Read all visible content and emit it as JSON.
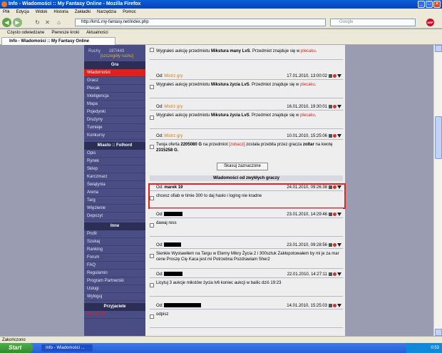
{
  "window": {
    "title": "Info - Wiadomości :: My Fantasy Online - Mozilla Firefox",
    "buttons": [
      "_",
      "□",
      "×"
    ]
  },
  "menu": [
    "Plik",
    "Edycja",
    "Widok",
    "Historia",
    "Zakładki",
    "Narzędzia",
    "Pomoc"
  ],
  "nav": {
    "url": "http://km1.my-fantasy.net/index.php",
    "search_placeholder": "Google",
    "back": "◀",
    "forward": "▶",
    "reload": "↻",
    "stop": "✕",
    "home": "⌂",
    "abp": "ABP"
  },
  "bookmarks": [
    "Często odwiedzane",
    "Pierwsze kroki",
    "Aktualności"
  ],
  "tab": {
    "label": "Info - Wiadomości :: My Fantasy Online"
  },
  "sidebar": {
    "stat_label": "Ruchy",
    "stat_value": "197/443",
    "stat_link": "[szczegóły ruchu]",
    "sections": [
      {
        "title": "Gra",
        "items": [
          "Wiadomości",
          "Gracz",
          "Plecak",
          "Inteligencja",
          "Mapa",
          "Pojedynki",
          "Drużyny",
          "Turnieje",
          "Konkursy"
        ]
      },
      {
        "title": "Miasto :: Folhord",
        "items": [
          "Opis",
          "Rynek",
          "Sklep",
          "Karczmarz",
          "Świątynia",
          "Arena",
          "Targ",
          "Więzienie",
          "Depozyt"
        ]
      },
      {
        "title": "Inne",
        "items": [
          "Profil",
          "Szukaj",
          "Ranking",
          "Forum",
          "FAQ",
          "Regulamin",
          "Program Partnerski",
          "Usługi",
          "Wyloguj"
        ]
      },
      {
        "title": "Przyjaciele",
        "items": [
          "marek 19"
        ]
      }
    ],
    "active": "Wiadomości"
  },
  "messages": [
    {
      "body_pre": "Wygrałeś aukcję przedmiotu ",
      "item": "Mikstura many LvS",
      "body_post": ". Przedmiot znajduje się w ",
      "link": "plecaku",
      "end": "."
    },
    {
      "from_label": "Od:",
      "from": "Mistrz gry",
      "date": "17.01.2010, 13:00:02",
      "body_pre": "Wygrałeś aukcję przedmiotu ",
      "item": "Mikstura życia LvS",
      "body_post": ". Przedmiot znajduje się w ",
      "link": "plecaku",
      "end": "."
    },
    {
      "from_label": "Od:",
      "from": "Mistrz gry",
      "date": "16.01.2010, 19:30:01",
      "body_pre": "Wygrałeś aukcję przedmiotu ",
      "item": "Mikstura życia LvS",
      "body_post": ". Przedmiot znajduje się w ",
      "link": "plecaku",
      "end": "."
    },
    {
      "from_label": "Od:",
      "from": "Mistrz gry",
      "date": "10.01.2010, 15:25:06",
      "body_pre": "Twoja oferta ",
      "item": "2205080 G",
      "body_post": " na przedmiot ",
      "link": "[zobacz]",
      "end": " została przebita przez gracza ",
      "player": "zoltar",
      "tail": " na kwotę ",
      "amount": "2315258 G."
    }
  ],
  "delete_button": "Skasuj zaznaczone",
  "players_section": "Wiadomości od zwykłych graczy",
  "player_messages": [
    {
      "from_label": "Od:",
      "from": "marek 19",
      "date": "24.01.2010, 09:26:38",
      "body": "chcesz ofiab w timie 300 to daj hasło i loging nie kradne"
    },
    {
      "from_label": "Od:",
      "date": "23.01.2010, 14:29:46",
      "body": "dawaj ress"
    },
    {
      "from_label": "Od:",
      "date": "23.01.2010, 09:28:56",
      "body": "Sienkie Wystawiłem na Targu w Eterny Mikry Życia 2 i 300sztuk Zakłopotowałem by mi je za mar cene Proszę Cię Kaca jest mi Potrzebna Pozdrawiam Sher2"
    },
    {
      "from_label": "Od:",
      "date": "22.01.2010, 14:27:11",
      "body": "Licytuj 3 aukcje mikstów życia lv6 koniec aukcji w bailic dziś 19:23"
    },
    {
      "from_label": "Od:",
      "date": "14.01.2010, 15:25:03",
      "body": "odpisz"
    }
  ],
  "status": "Zakończono",
  "taskbar": {
    "start": "Start",
    "task": "Info - Wiadomości ...",
    "clock": "0:53"
  },
  "colors": {
    "sidebar": "#4a4d84",
    "active": "#e0201a",
    "highlight": "#e32222"
  }
}
